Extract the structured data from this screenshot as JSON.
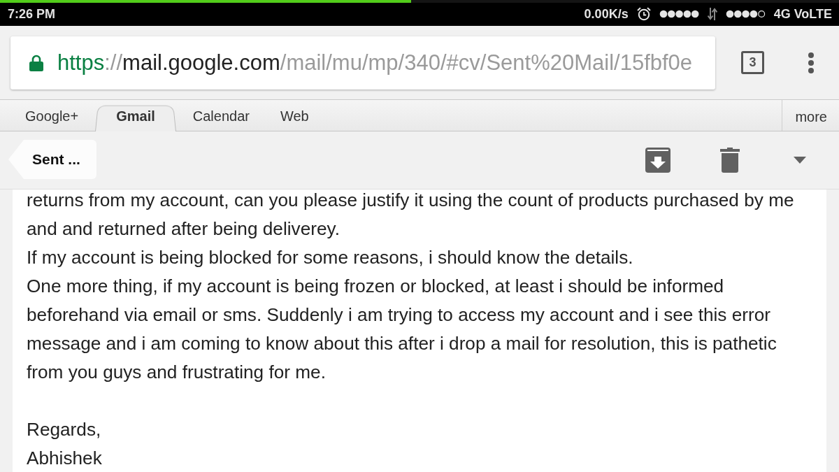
{
  "status_bar": {
    "time": "7:26 PM",
    "net_speed": "0.00K/s",
    "network": "4G VoLTE"
  },
  "load_progress": {
    "level": 0.49
  },
  "address_bar": {
    "scheme": "https",
    "separator": "://",
    "host": "mail.google.com",
    "path": "/mail/mu/mp/340/#cv/Sent%20Mail/15fbf0e"
  },
  "tab_count": "3",
  "tabs": [
    {
      "label": "Google+",
      "selected": false
    },
    {
      "label": "Gmail",
      "selected": true
    },
    {
      "label": "Calendar",
      "selected": false
    },
    {
      "label": "Web",
      "selected": false
    }
  ],
  "more_tab": "more",
  "toolbar": {
    "back_label": "Sent ..."
  },
  "message": {
    "paragraphs": [
      {
        "lines": [
          "returns from my account, can you please justify it using the count of products purchased by me",
          "and and returned after being deliverey."
        ]
      },
      {
        "lines": [
          "If my account is being blocked for some reasons, i should know the details."
        ]
      },
      {
        "lines": [
          "One more thing, if my account is being frozen or blocked, at least i should be informed",
          "beforehand via email or sms. Suddenly i am trying to access my account and i see this error",
          "message and i am coming to know about this after i drop a mail for resolution, this is pathetic",
          "from you guys and frustrating for me."
        ]
      }
    ],
    "closing": "Regards,",
    "signature": "Abhishek"
  }
}
